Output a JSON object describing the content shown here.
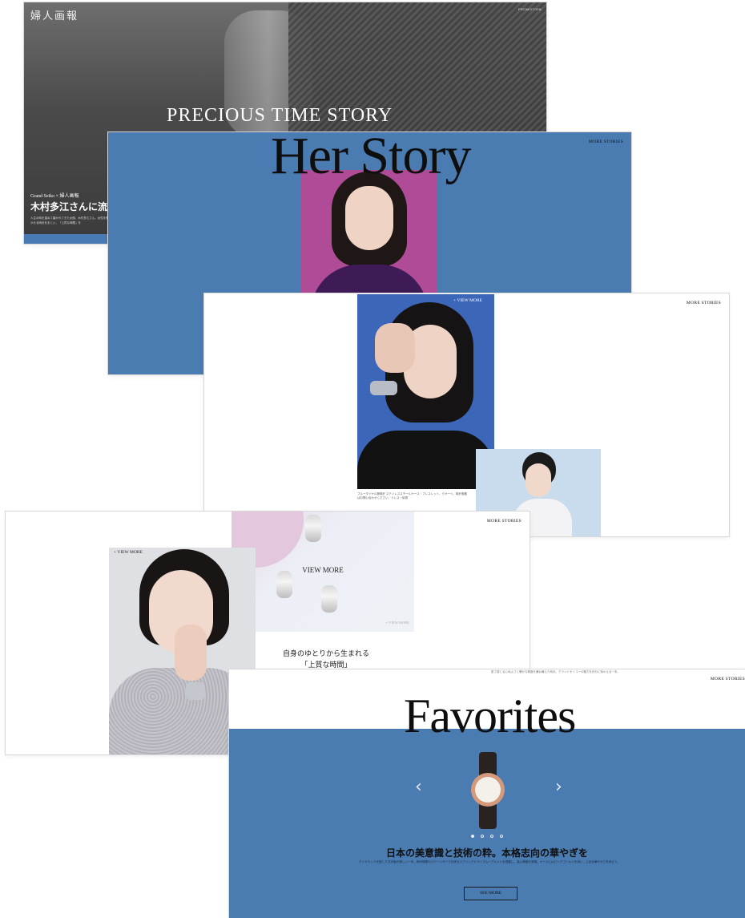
{
  "panel1": {
    "logo": "婦人画報",
    "promo_label": "PROMOTION",
    "hero_title": "PRECIOUS TIME STORY",
    "collab": "Grand Seiko × 婦人画報",
    "headline": "木村多江さんに流れ",
    "lead": "人生の時を重ねて磨かれてきた女優、木村多江さん。女性を輝かせる時計をまとい、「上質な時間」を"
  },
  "panel2": {
    "big_title": "Her Story",
    "more_stories": "MORE STORIES"
  },
  "panel3": {
    "more_stories": "MORE STORIES",
    "view_more": "+ VIEW MORE",
    "caption": "ブルーダイヤル腕時計 ステンレススチールケース・ブレスレット、クオーツ。時計価格はお問い合わせください。ドレス・私物"
  },
  "panel4": {
    "more_stories": "MORE STORIES",
    "view_more": "+ VIEW MORE",
    "shop_view_more": "VIEW MORE",
    "shop_link": "+ VIEW MORE",
    "copy_line1": "自身のゆとりから生まれる",
    "copy_line2": "「上質な時間」"
  },
  "panel5": {
    "top_note": "肌で感じる心地よさと確かな精度を兼ね備えた時計。グランドセイコーの魅力を存分に味わえる一本。",
    "more_stories": "MORE STORIES",
    "big_title": "Favorites",
    "prev_symbol": "‹",
    "next_symbol": "›",
    "dots": {
      "count": 4,
      "active": 1
    },
    "headline": "日本の美意識と技術の粋。本格志向の華やぎを",
    "body": "ダイヤモンドを配した文字板が美しい一本。約60時間のパワーリザーブを誇るスプリングドライブムーブメントを搭載し、高い精度を実現。ケースにはピンクゴールドを用い、上品な華やかさを添えて。",
    "see_more": "SEE MORE"
  },
  "colors": {
    "accent_blue": "#4a7bb1",
    "dark_hero": "#3b3b3b"
  }
}
